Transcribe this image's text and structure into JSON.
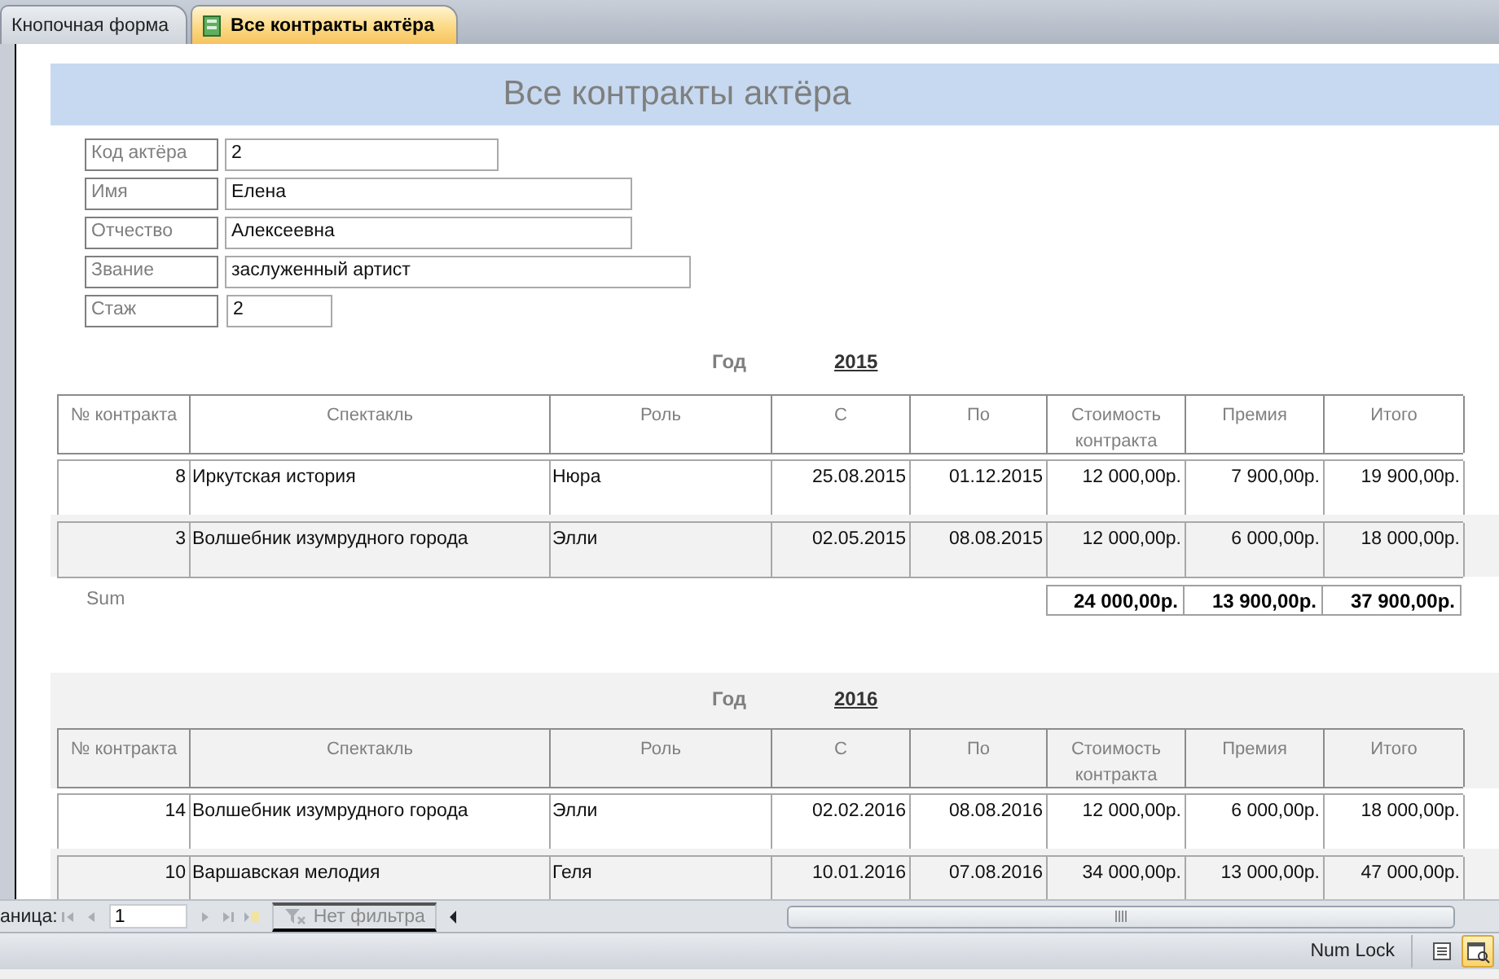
{
  "tabs": [
    {
      "label": "Кнопочная форма",
      "selected": false
    },
    {
      "label": "Все контракты актёра",
      "selected": true
    }
  ],
  "report": {
    "title": "Все контракты актёра",
    "fields": [
      {
        "label": "Код актёра",
        "value": "2"
      },
      {
        "label": "Имя",
        "value": "Елена"
      },
      {
        "label": "Отчество",
        "value": "Алексеевна"
      },
      {
        "label": "Звание",
        "value": "заслуженный артист"
      },
      {
        "label": "Стаж",
        "value": "2"
      }
    ],
    "groups": [
      {
        "year_label": "Год",
        "year": "2015",
        "shaded": false,
        "columns": [
          "№ контракта",
          "Спектакль",
          "Роль",
          "С",
          "По",
          "Стоимость контракта",
          "Премия",
          "Итого"
        ],
        "rows": [
          {
            "shaded": false,
            "cells": [
              "8",
              "Иркутская история",
              "Нюра",
              "25.08.2015",
              "01.12.2015",
              "12 000,00р.",
              "7 900,00р.",
              "19 900,00р."
            ]
          },
          {
            "shaded": true,
            "cells": [
              "3",
              "Волшебник изумрудного города",
              "Элли",
              "02.05.2015",
              "08.08.2015",
              "12 000,00р.",
              "6 000,00р.",
              "18 000,00р."
            ]
          }
        ],
        "sum": {
          "label": "Sum",
          "values": [
            "24 000,00р.",
            "13 900,00р.",
            "37 900,00р."
          ]
        }
      },
      {
        "year_label": "Год",
        "year": "2016",
        "shaded": true,
        "columns": [
          "№ контракта",
          "Спектакль",
          "Роль",
          "С",
          "По",
          "Стоимость контракта",
          "Премия",
          "Итого"
        ],
        "rows": [
          {
            "shaded": false,
            "cells": [
              "14",
              "Волшебник изумрудного города",
              "Элли",
              "02.02.2016",
              "08.08.2016",
              "12 000,00р.",
              "6 000,00р.",
              "18 000,00р."
            ]
          },
          {
            "shaded": true,
            "cells": [
              "10",
              "Варшавская мелодия",
              "Геля",
              "10.01.2016",
              "07.08.2016",
              "34 000,00р.",
              "13 000,00р.",
              "47 000,00р."
            ]
          }
        ]
      }
    ]
  },
  "navigation": {
    "label": "аница:",
    "page": "1",
    "filter": "Нет фильтра"
  },
  "status_bar": {
    "text": "Num Lock",
    "views": [
      {
        "selected": false
      },
      {
        "selected": true
      }
    ]
  }
}
